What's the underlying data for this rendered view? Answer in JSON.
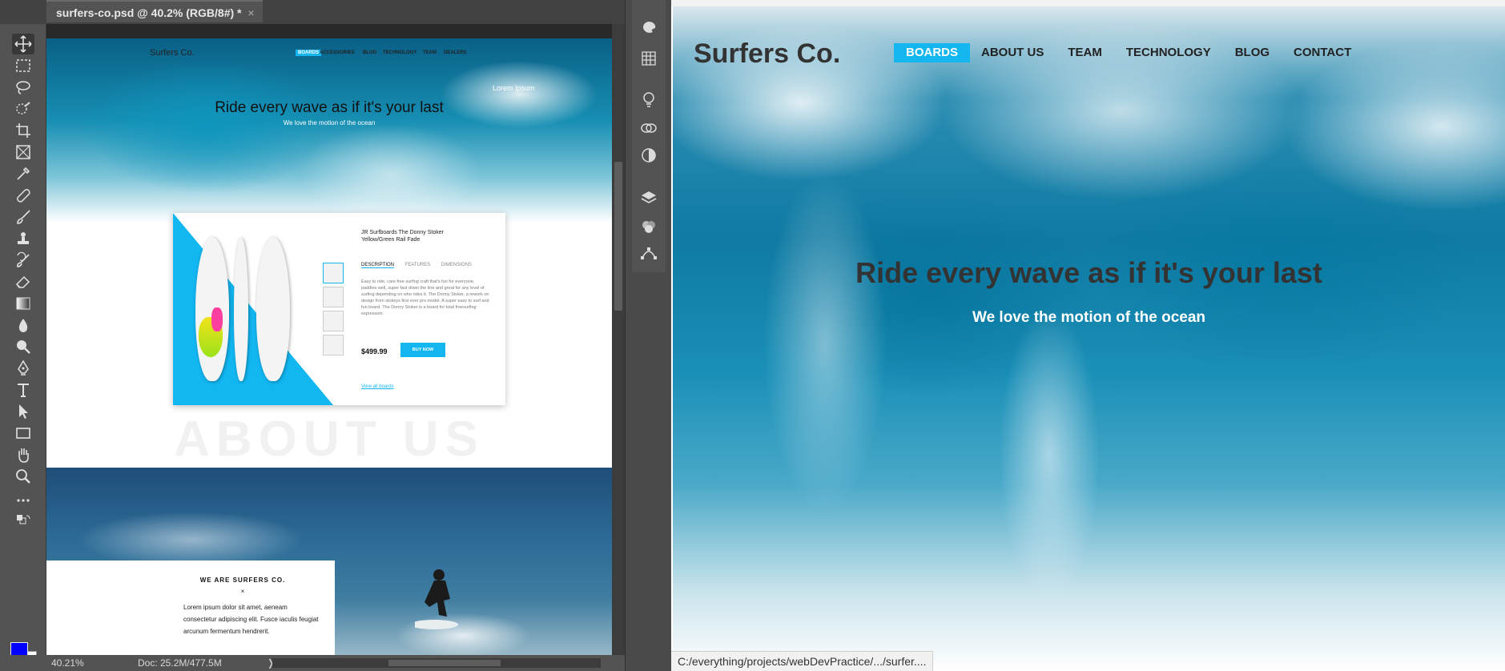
{
  "photoshop": {
    "tab_title": "surfers-co.psd @ 40.2% (RGB/8#) *",
    "tab_close": "×",
    "status_zoom": "40.21%",
    "status_doc": "Doc: 25.2M/477.5M",
    "status_arrow": "❭",
    "foreground_color": "#0000ff",
    "background_color": "#ffffff",
    "tools": [
      "move-icon",
      "marquee-icon",
      "lasso-icon",
      "quick-select-icon",
      "crop-icon",
      "frame-icon",
      "eyedropper-icon",
      "healing-brush-icon",
      "brush-icon",
      "clone-stamp-icon",
      "history-brush-icon",
      "eraser-icon",
      "gradient-icon",
      "blur-icon",
      "dodge-icon",
      "pen-icon",
      "type-icon",
      "path-select-icon",
      "rectangle-icon",
      "hand-icon",
      "zoom-icon",
      "more-tools-icon"
    ],
    "panels": [
      "color-panel-icon",
      "swatches-panel-icon",
      "learn-panel-icon",
      "libraries-panel-icon",
      "adjustments-panel-icon",
      "layers-panel-icon",
      "channels-panel-icon",
      "paths-panel-icon"
    ],
    "document": {
      "logo": "Surfers Co.",
      "nav": [
        "BOARDS",
        "ACCESSORIES",
        "BLOG",
        "TECHNOLOGY",
        "TEAM",
        "DEALERS"
      ],
      "corner_text": "Lorem Ipsum",
      "headline": "Ride every wave as if it's your last",
      "subline": "We love the motion of the ocean",
      "card": {
        "title": "JR Surfboards The Donny Stoker Yellow/Green Rail Fade",
        "tabs": [
          "DESCRIPTION",
          "FEATURES",
          "DIMENSIONS"
        ],
        "description": "Easy to ride, care free surfing craft that's fun for everyone, paddles well, super fast down the line and great for any level of surfing depending on who rides it. The Donny Stoker, a rework on design from stokeys first ever pro model. A super easy to surf and fun board. The Donny Stoker is a board for total freesurfing expression.",
        "price": "$499.99",
        "buy_label": "BUY NOW",
        "link": "View all boards"
      },
      "about_ghost": "ABOUT US",
      "we_are": "WE ARE SURFERS CO.",
      "divider": "×",
      "lorem": "Lorem ipsum dolor sit amet, aeneam consectetur adipiscing elit. Fusce iaculis feugiat arcunum fermentum hendrerit."
    }
  },
  "browser": {
    "logo": "Surfers Co.",
    "nav": [
      {
        "label": "BOARDS",
        "active": true
      },
      {
        "label": "ABOUT US",
        "active": false
      },
      {
        "label": "TEAM",
        "active": false
      },
      {
        "label": "TECHNOLOGY",
        "active": false
      },
      {
        "label": "BLOG",
        "active": false
      },
      {
        "label": "CONTACT",
        "active": false
      }
    ],
    "headline": "Ride every wave as if it's your last",
    "subline": "We love the motion of the ocean",
    "status_url": "C:/everything/projects/webDevPractice/.../surfer....",
    "accent_color": "#14b6f0"
  }
}
